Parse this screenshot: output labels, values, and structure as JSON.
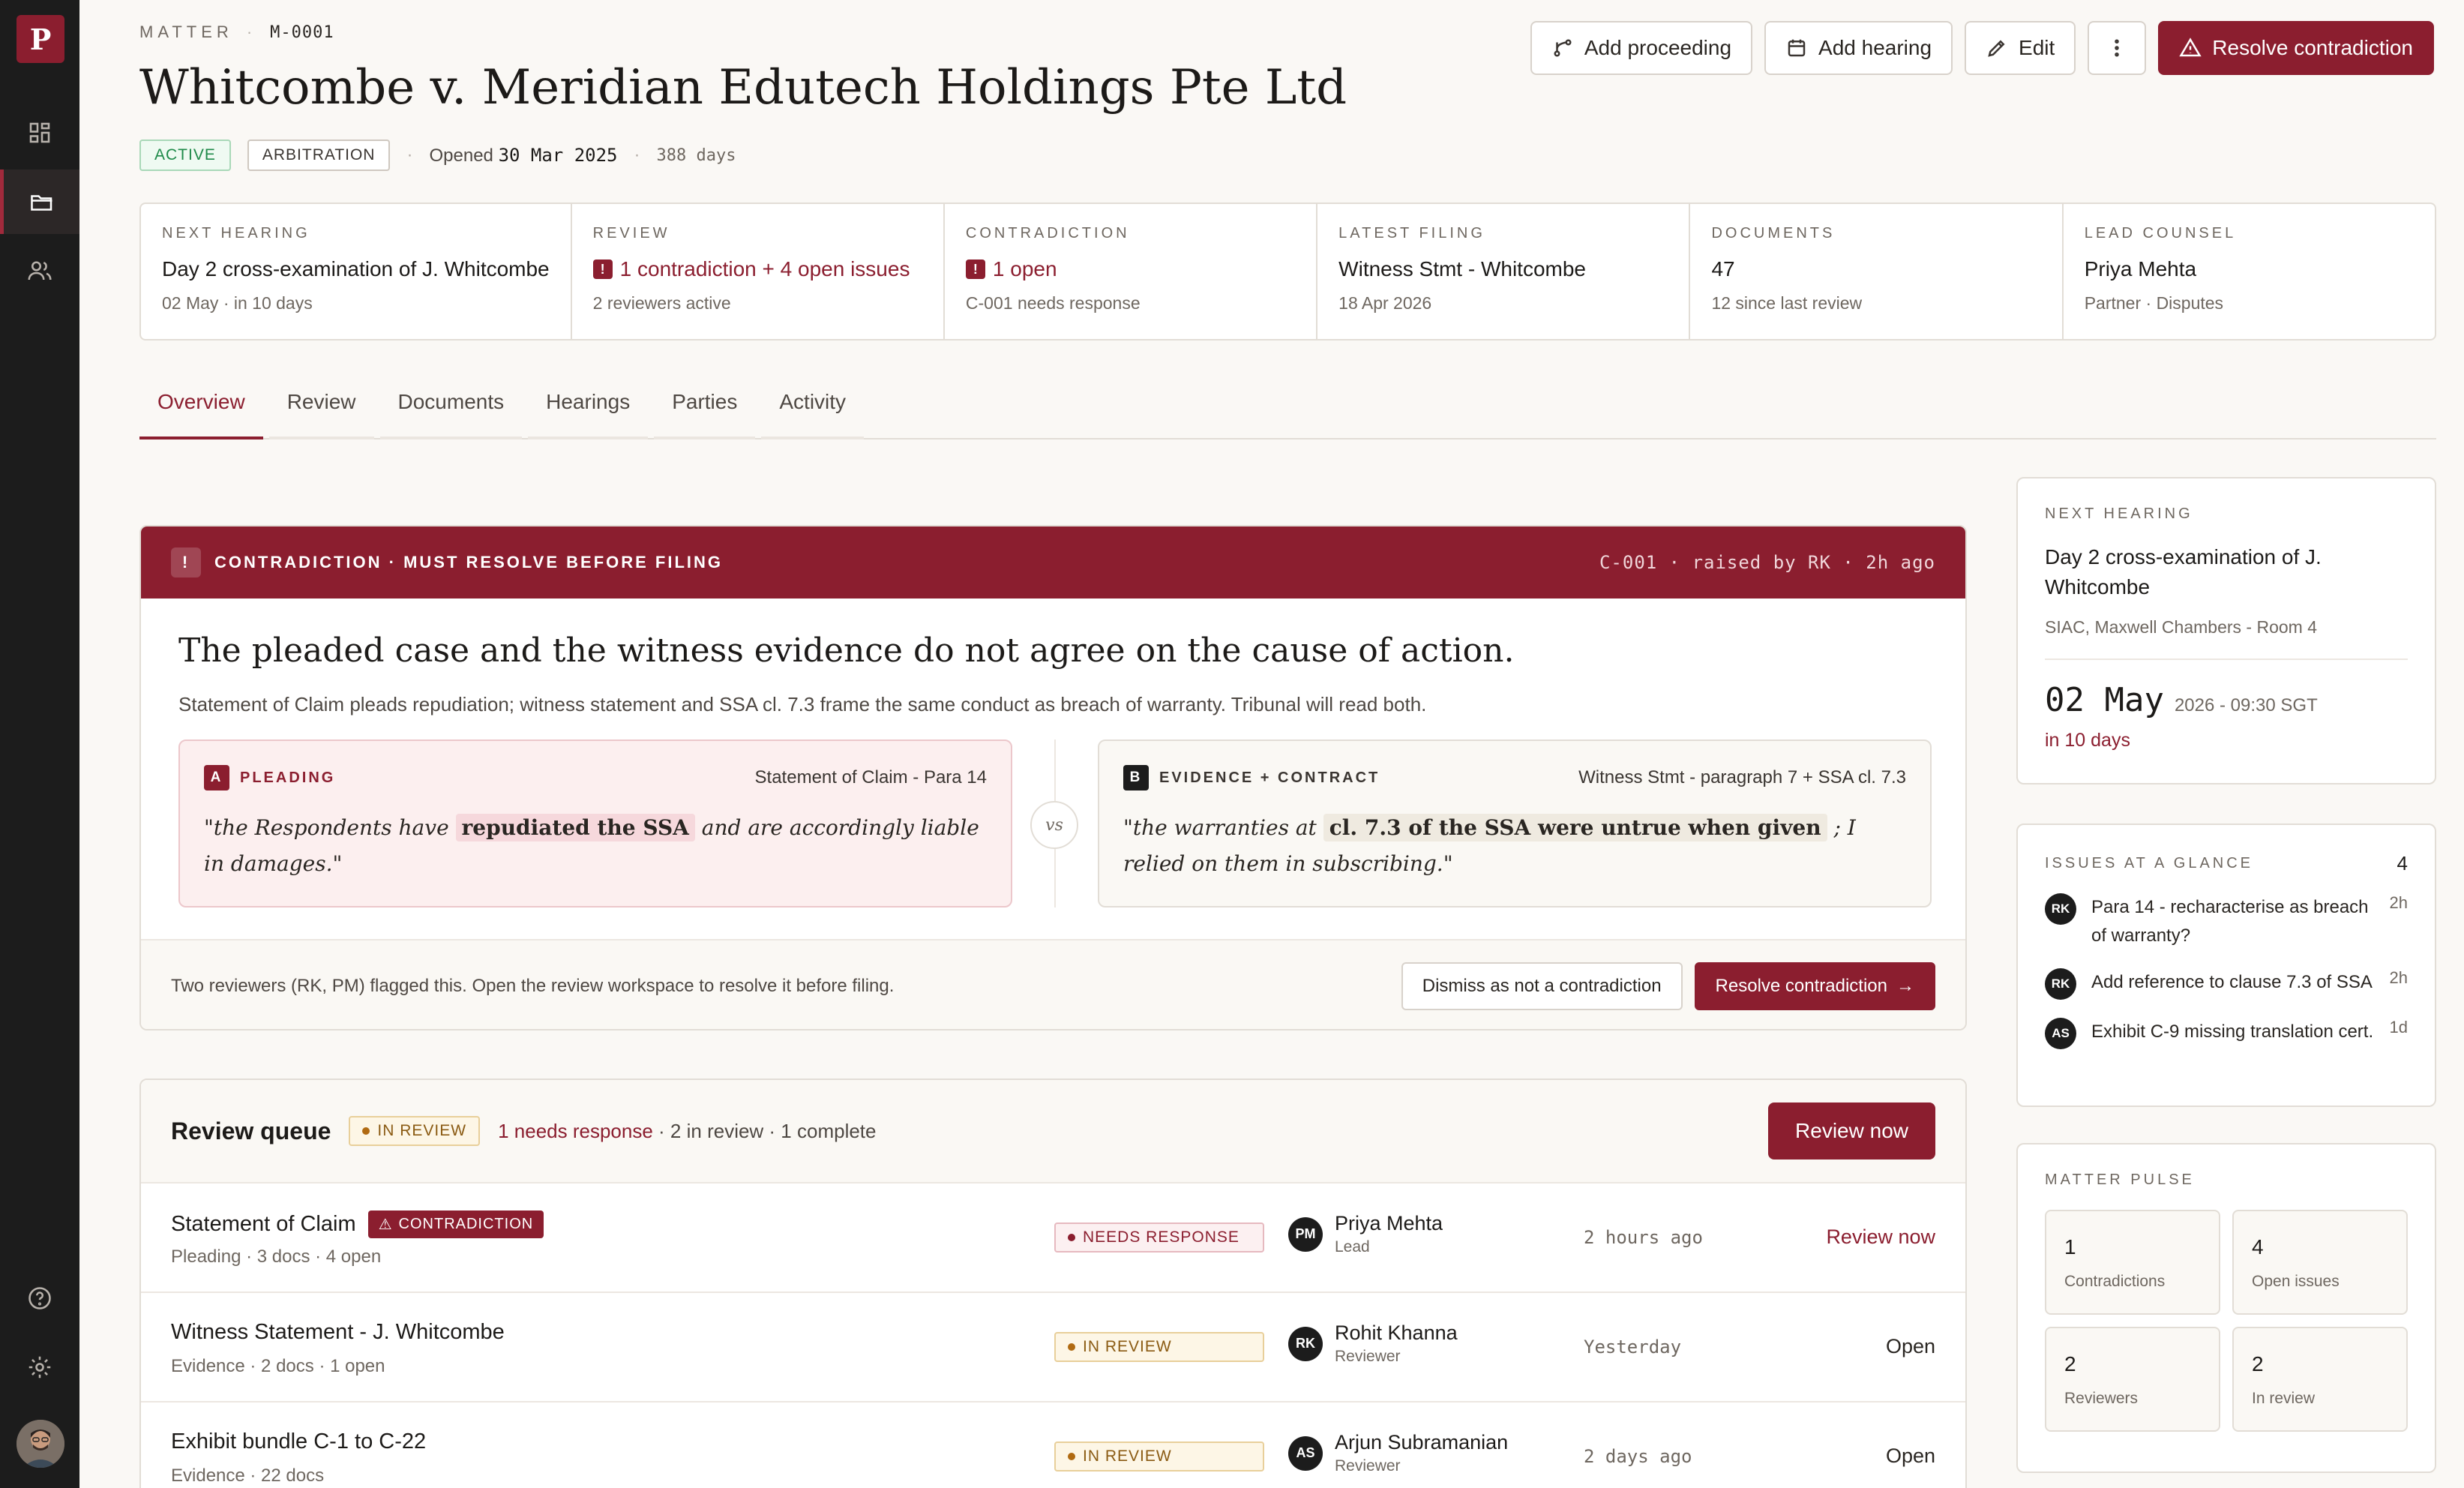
{
  "sidebar": {
    "logo": "P",
    "nav": [
      "dashboard-icon",
      "folder-icon",
      "users-icon"
    ],
    "bottom": [
      "help-icon",
      "settings-icon"
    ]
  },
  "header": {
    "eyebrow": "MATTER",
    "matter_id": "M-0001",
    "title": "Whitcombe v. Meridian Edutech Holdings Pte Ltd",
    "tag_status": "ACTIVE",
    "tag_type": "ARBITRATION",
    "opened_label": "Opened",
    "opened_date": "30 Mar 2025",
    "age": "388 days"
  },
  "actions": {
    "add_proceeding": "Add proceeding",
    "add_hearing": "Add hearing",
    "edit": "Edit",
    "resolve": "Resolve contradiction"
  },
  "stats": [
    {
      "label": "NEXT HEARING",
      "value": "Day 2 cross-examination of J. Whitcombe",
      "sub": "02 May · in 10 days"
    },
    {
      "label": "REVIEW",
      "value": "1 contradiction + 4 open issues",
      "sub": "2 reviewers active"
    },
    {
      "label": "CONTRADICTION",
      "value": "1 open",
      "sub": "C-001 needs response"
    },
    {
      "label": "LATEST FILING",
      "value": "Witness Stmt - Whitcombe",
      "sub": "18 Apr 2026"
    },
    {
      "label": "DOCUMENTS",
      "value": "47",
      "sub": "12 since last review"
    },
    {
      "label": "LEAD COUNSEL",
      "value": "Priya Mehta",
      "sub": "Partner · Disputes"
    }
  ],
  "tabs": [
    "Overview",
    "Review",
    "Documents",
    "Hearings",
    "Parties",
    "Activity"
  ],
  "contradiction": {
    "banner": "CONTRADICTION · MUST RESOLVE BEFORE FILING",
    "ref": "C-001 · raised by RK · 2h ago",
    "title": "The pleaded case and the witness evidence do not agree on the cause of action.",
    "desc": "Statement of Claim pleads repudiation; witness statement and SSA cl. 7.3 frame the same conduct as breach of warranty. Tribunal will read both.",
    "a": {
      "badge": "A",
      "kind": "PLEADING",
      "source": "Statement of Claim - Para 14",
      "pre": "\"the Respondents have",
      "hl": "repudiated the SSA",
      "post": "and are accordingly liable in damages.\""
    },
    "vs": "vs",
    "b": {
      "badge": "B",
      "kind": "EVIDENCE + CONTRACT",
      "source": "Witness Stmt - paragraph 7 + SSA cl. 7.3",
      "pre": "\"the warranties at",
      "hl": "cl. 7.3 of the SSA were untrue when given",
      "post": "; I relied on them in subscribing.\""
    },
    "footer_text": "Two reviewers (RK, PM) flagged this. Open the review workspace to resolve it before filing.",
    "dismiss": "Dismiss as not a contradiction",
    "resolve": "Resolve contradiction"
  },
  "review_queue": {
    "title": "Review queue",
    "status": "IN REVIEW",
    "summary_red": "1 needs response",
    "summary_rest": "· 2 in review · 1 complete",
    "cta": "Review now",
    "rows": [
      {
        "name": "Statement of Claim",
        "tag": "CONTRADICTION",
        "desc": "Pleading · 3 docs · 4 open",
        "status": "NEEDS RESPONSE",
        "initials": "PM",
        "person": "Priya Mehta",
        "role": "Lead",
        "when": "2 hours ago",
        "action": "Review now"
      },
      {
        "name": "Witness Statement - J. Whitcombe",
        "tag": "",
        "desc": "Evidence · 2 docs · 1 open",
        "status": "IN REVIEW",
        "initials": "RK",
        "person": "Rohit Khanna",
        "role": "Reviewer",
        "when": "Yesterday",
        "action": "Open"
      },
      {
        "name": "Exhibit bundle C-1 to C-22",
        "tag": "",
        "desc": "Evidence · 22 docs",
        "status": "IN REVIEW",
        "initials": "AS",
        "person": "Arjun Subramanian",
        "role": "Reviewer",
        "when": "2 days ago",
        "action": "Open"
      }
    ]
  },
  "next_hearing": {
    "label": "NEXT HEARING",
    "title": "Day 2 cross-examination of J. Whitcombe",
    "location": "SIAC, Maxwell Chambers - Room 4",
    "date": "02 May",
    "time": "2026 - 09:30 SGT",
    "in": "in 10 days"
  },
  "issues": {
    "label": "ISSUES AT A GLANCE",
    "count": "4",
    "items": [
      {
        "initials": "RK",
        "text": "Para 14 - recharacterise as breach of warranty?",
        "age": "2h"
      },
      {
        "initials": "RK",
        "text": "Add reference to clause 7.3 of SSA",
        "age": "2h"
      },
      {
        "initials": "AS",
        "text": "Exhibit C-9 missing translation cert.",
        "age": "1d"
      }
    ]
  },
  "pulse": {
    "label": "MATTER PULSE",
    "cells": [
      {
        "n": "1",
        "l": "Contradictions"
      },
      {
        "n": "4",
        "l": "Open issues"
      },
      {
        "n": "2",
        "l": "Reviewers"
      },
      {
        "n": "2",
        "l": "In review"
      }
    ]
  }
}
